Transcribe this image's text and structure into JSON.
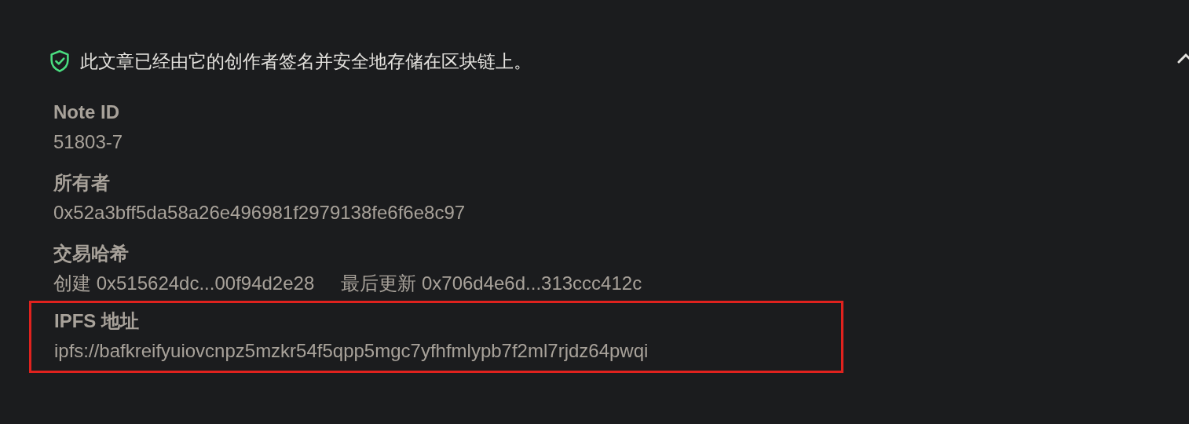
{
  "notice": {
    "text": "此文章已经由它的创作者签名并安全地存储在区块链上。",
    "expanded": true
  },
  "fields": [
    {
      "kind": "text",
      "label": "Note ID",
      "value": "51803-7",
      "highlighted": false
    },
    {
      "kind": "text",
      "label": "所有者",
      "value": "0x52a3bff5da58a26e496981f2979138fe6f6e8c97",
      "highlighted": false
    },
    {
      "kind": "tx",
      "label": "交易哈希",
      "items": [
        {
          "prefix": "创建",
          "hash": "0x515624dc...00f94d2e28"
        },
        {
          "prefix": "最后更新",
          "hash": "0x706d4e6d...313ccc412c"
        }
      ],
      "highlighted": false
    },
    {
      "kind": "text",
      "label": "IPFS 地址",
      "value": "ipfs://bafkreifyuiovcnpz5mzkr54f5qpp5mgc7yfhfmlypb7f2ml7rjdz64pwqi",
      "highlighted": true
    }
  ]
}
